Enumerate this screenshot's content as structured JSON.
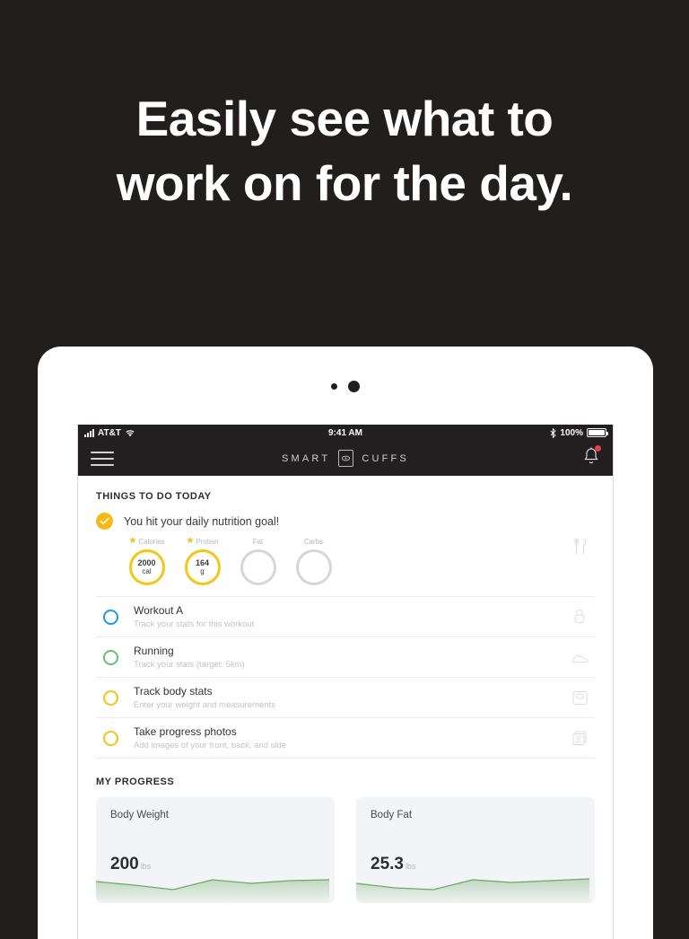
{
  "marketing": {
    "headline_line1": "Easily see what to",
    "headline_line2": "work on for the day."
  },
  "device": {
    "camera_icon": "camera-dot",
    "sensor_icon": "sensor-dot"
  },
  "status_bar": {
    "carrier": "AT&T",
    "signal_icon": "signal-bars-icon",
    "wifi_icon": "wifi-icon",
    "time": "9:41 AM",
    "bluetooth_icon": "bluetooth-icon",
    "battery_percent": "100%",
    "battery_icon": "battery-full-icon"
  },
  "navbar": {
    "menu_icon": "hamburger-menu-icon",
    "brand_left": "SMART",
    "brand_right": "CUFFS",
    "brand_mark_icon": "smart-cuffs-logo-icon",
    "bell_icon": "notification-bell-icon",
    "has_notification": true
  },
  "sections": {
    "todo_title": "THINGS TO DO TODAY",
    "progress_title": "MY PROGRESS"
  },
  "nutrition": {
    "check_icon": "checkmark-icon",
    "headline": "You hit your daily nutrition goal!",
    "row_icon": "fork-knife-icon",
    "rings": [
      {
        "label": "Calories",
        "starred": true,
        "value": "2000",
        "unit": "cal",
        "complete": true
      },
      {
        "label": "Protein",
        "starred": true,
        "value": "164",
        "unit": "g",
        "complete": true
      },
      {
        "label": "Fat",
        "starred": false,
        "value": "",
        "unit": "",
        "complete": false
      },
      {
        "label": "Carbs",
        "starred": false,
        "value": "",
        "unit": "",
        "complete": false
      }
    ]
  },
  "tasks": [
    {
      "title": "Workout A",
      "subtitle": "Track your stats for this workout",
      "radio_color": "#1e9ae0",
      "icon": "kettlebell-icon"
    },
    {
      "title": "Running",
      "subtitle": "Track your stats (target: 5km)",
      "radio_color": "#5fc46b",
      "icon": "running-shoe-icon"
    },
    {
      "title": "Track body stats",
      "subtitle": "Enter your weight and measurements",
      "radio_color": "#f5c518",
      "icon": "body-scale-icon"
    },
    {
      "title": "Take progress photos",
      "subtitle": "Add images of your front, back, and side",
      "radio_color": "#f5c518",
      "icon": "progress-photos-icon"
    }
  ],
  "progress_cards": [
    {
      "label": "Body Weight",
      "value": "200",
      "unit": "lbs",
      "chart_icon": "sparkline-area-chart"
    },
    {
      "label": "Body Fat",
      "value": "25.3",
      "unit": "lbs",
      "chart_icon": "sparkline-area-chart"
    }
  ],
  "colors": {
    "background": "#211e1d",
    "accent_yellow": "#f5c518",
    "accent_blue": "#1e9ae0",
    "accent_green": "#5fc46b",
    "badge_red": "#ee3d4a",
    "chart_green": "#6aaa64"
  },
  "chart_data": [
    {
      "type": "area",
      "title": "Body Weight",
      "ylabel": "lbs",
      "x": [
        0,
        1,
        2,
        3,
        4,
        5,
        6
      ],
      "values": [
        200,
        198,
        201,
        200,
        200,
        201,
        201
      ],
      "current": 200
    },
    {
      "type": "area",
      "title": "Body Fat",
      "ylabel": "lbs",
      "x": [
        0,
        1,
        2,
        3,
        4,
        5,
        6
      ],
      "values": [
        25.3,
        25.0,
        25.2,
        25.6,
        25.4,
        25.5,
        25.7
      ],
      "current": 25.3
    }
  ]
}
